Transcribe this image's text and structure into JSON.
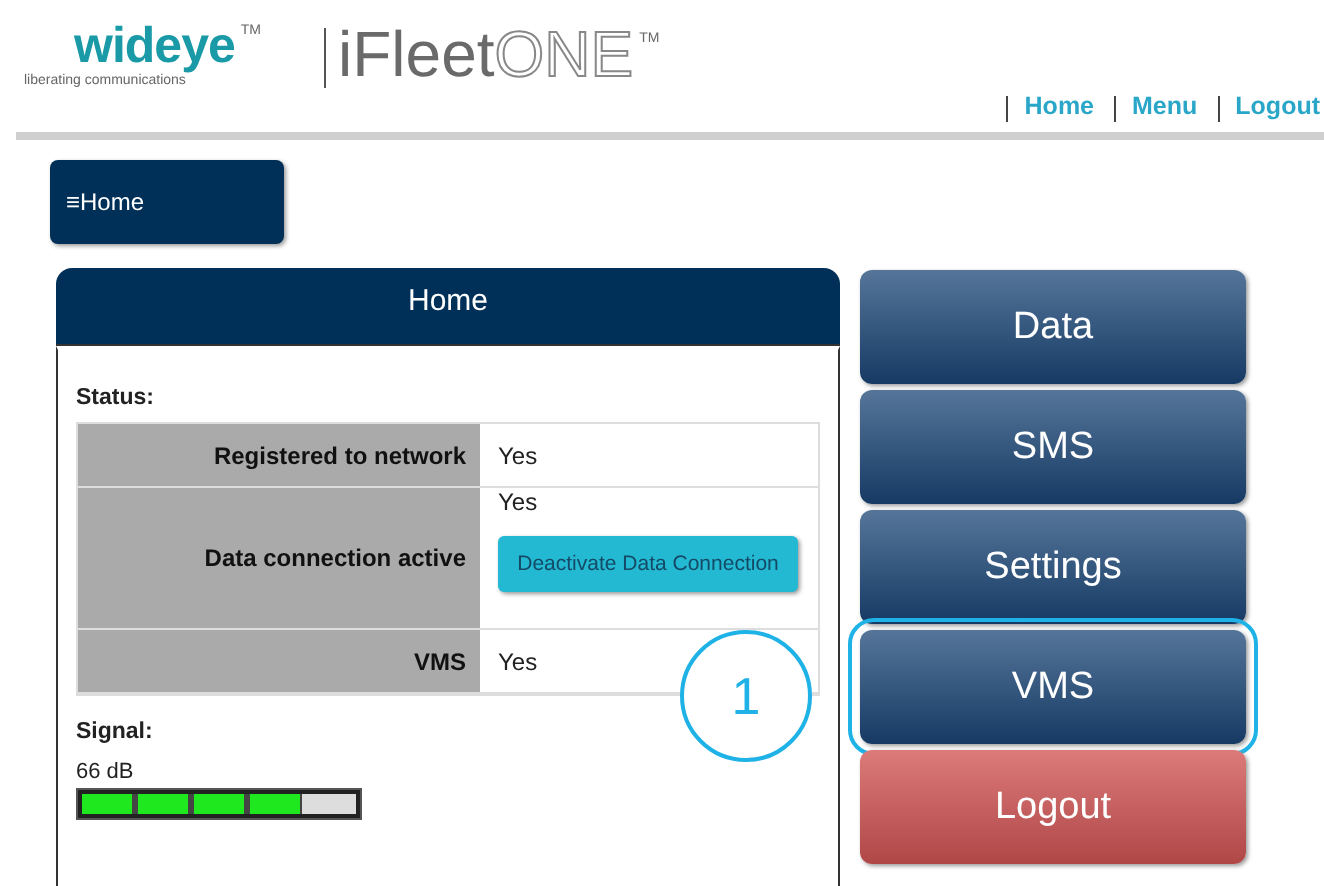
{
  "brand": {
    "logo": "wideye",
    "logo_mark": "TM",
    "tagline": "liberating communications",
    "product": "iFleet",
    "product_suffix": "ONE",
    "product_mark": "TM"
  },
  "top_links": [
    "Home",
    "Menu",
    "Logout"
  ],
  "menu_button": {
    "icon": "≡",
    "label": "Home"
  },
  "panel": {
    "title": "Home",
    "status_label": "Status:",
    "rows": [
      {
        "label": "Registered to network",
        "value": "Yes"
      },
      {
        "label": "Data connection active",
        "value": "Yes",
        "action": "Deactivate Data Connection"
      },
      {
        "label": "VMS",
        "value": "Yes"
      }
    ],
    "signal_label": "Signal:",
    "signal_reading": "66 dB",
    "signal": {
      "level": 0.8
    }
  },
  "nav_buttons": [
    {
      "label": "Data",
      "kind": "primary",
      "highlighted": false
    },
    {
      "label": "SMS",
      "kind": "primary",
      "highlighted": false
    },
    {
      "label": "Settings",
      "kind": "primary",
      "highlighted": false
    },
    {
      "label": "VMS",
      "kind": "primary",
      "highlighted": true
    },
    {
      "label": "Logout",
      "kind": "danger",
      "highlighted": false
    }
  ],
  "callout": "1"
}
